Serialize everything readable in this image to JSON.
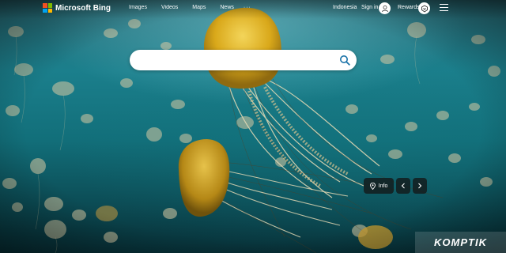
{
  "header": {
    "brand": "Microsoft Bing",
    "nav": [
      "Images",
      "Videos",
      "Maps",
      "News"
    ],
    "more": "···",
    "language": "Indonesia",
    "sign_in": "Sign in",
    "rewards": "Rewards"
  },
  "search": {
    "value": "",
    "placeholder": ""
  },
  "image_controls": {
    "info_label": "Info"
  },
  "watermark": {
    "text": "KOMPTIK"
  },
  "colors": {
    "ms_red": "#f25022",
    "ms_green": "#7fba00",
    "ms_blue": "#00a4ef",
    "ms_yellow": "#ffb900",
    "search_icon": "#1a73a8",
    "jelly": "#e0b21f"
  },
  "icons": [
    "microsoft-logo-icon",
    "user-icon",
    "rewards-icon",
    "menu-icon",
    "search-icon",
    "location-pin-icon",
    "chevron-left-icon",
    "chevron-right-icon"
  ]
}
